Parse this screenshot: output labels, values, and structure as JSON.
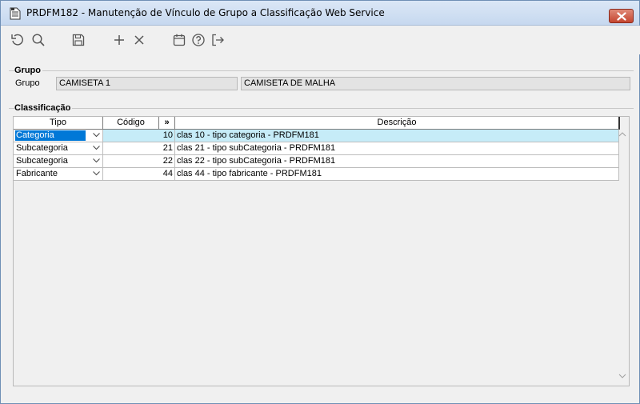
{
  "window": {
    "title": "PRDFM182 - Manutenção de Vínculo de Grupo a Classificação Web Service",
    "close_icon": "close-icon"
  },
  "toolbar": {
    "icons": [
      "undo-icon",
      "search-icon",
      "save-icon",
      "add-icon",
      "delete-icon",
      "calendar-icon",
      "help-icon",
      "exit-icon"
    ]
  },
  "grupo": {
    "section_title": "Grupo",
    "label": "Grupo",
    "code_value": "CAMISETA 1",
    "desc_value": "CAMISETA DE MALHA"
  },
  "classificacao": {
    "section_title": "Classificação",
    "columns": {
      "tipo": "Tipo",
      "codigo": "Código",
      "lookup": "»",
      "descricao": "Descrição"
    },
    "rows": [
      {
        "tipo": "Categoria",
        "codigo": "10",
        "descricao": "clas 10 - tipo categoria - PRDFM181",
        "selected": true
      },
      {
        "tipo": "Subcategoria",
        "codigo": "21",
        "descricao": "clas 21 - tipo subCategoria - PRDFM181",
        "selected": false
      },
      {
        "tipo": "Subcategoria",
        "codigo": "22",
        "descricao": "clas 22 - tipo subCategoria - PRDFM181",
        "selected": false
      },
      {
        "tipo": "Fabricante",
        "codigo": "44",
        "descricao": "clas 44 - tipo fabricante - PRDFM181",
        "selected": false
      }
    ]
  },
  "colors": {
    "selection": "#0078d7",
    "selected_row": "#c6ecf8",
    "close_button": "#c4452f"
  }
}
